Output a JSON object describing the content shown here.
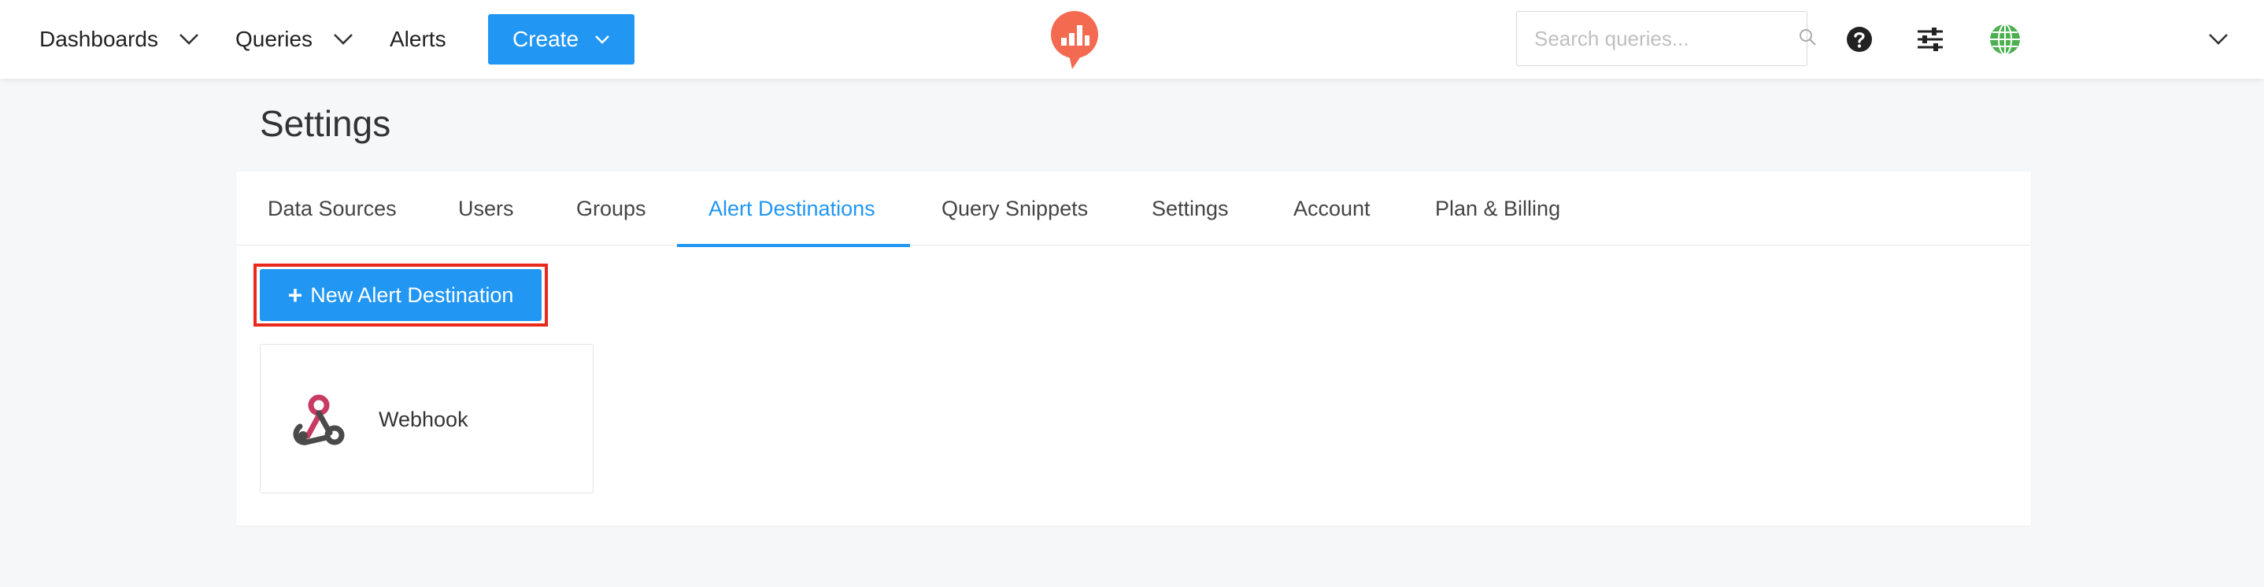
{
  "navbar": {
    "dashboards_label": "Dashboards",
    "queries_label": "Queries",
    "alerts_label": "Alerts",
    "create_label": "Create",
    "search_placeholder": "Search queries...",
    "logo_icon": "redash-logo-icon",
    "help_icon": "question-circle-icon",
    "settings_icon": "sliders-icon",
    "avatar_icon": "globe-avatar-icon",
    "user_menu_icon": "chevron-down-icon"
  },
  "page": {
    "title": "Settings"
  },
  "tabs": [
    {
      "label": "Data Sources"
    },
    {
      "label": "Users"
    },
    {
      "label": "Groups"
    },
    {
      "label": "Alert Destinations",
      "active": true
    },
    {
      "label": "Query Snippets"
    },
    {
      "label": "Settings"
    },
    {
      "label": "Account"
    },
    {
      "label": "Plan & Billing"
    }
  ],
  "content": {
    "new_button_icon": "+",
    "new_button_label": "New Alert Destination",
    "destinations": [
      {
        "label": "Webhook",
        "icon": "webhook-icon"
      }
    ]
  },
  "colors": {
    "accent": "#2196f3",
    "logo": "#f46a51",
    "highlight": "#e8291c",
    "avatar": "#4caf50"
  }
}
